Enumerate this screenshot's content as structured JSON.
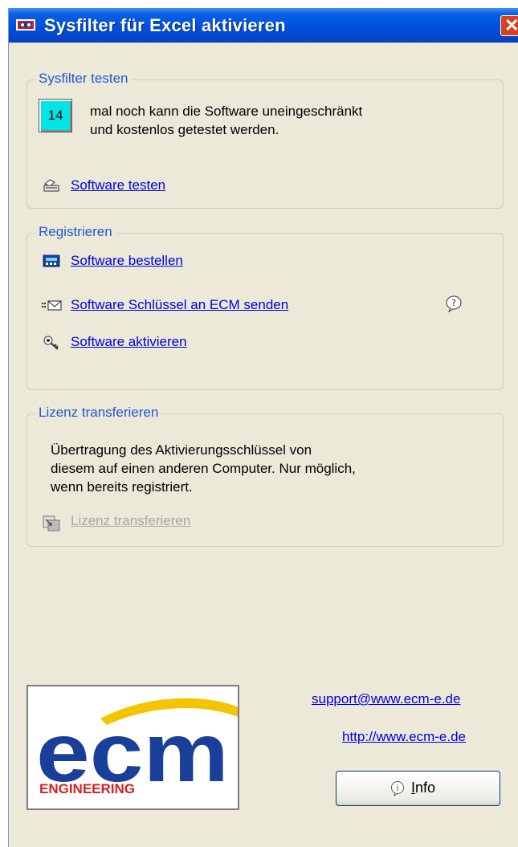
{
  "window": {
    "title": "Sysfilter für Excel aktivieren",
    "close_label": "✕"
  },
  "test_group": {
    "legend": "Sysfilter testen",
    "remaining_count": "14",
    "description_line1": "mal noch kann die Software uneingeschränkt",
    "description_line2": "und kostenlos getestet werden.",
    "test_link": "Software testen"
  },
  "register_group": {
    "legend": "Registrieren",
    "order_link": "Software bestellen",
    "send_key_link": "Software Schlüssel an ECM senden",
    "activate_link": "Software aktivieren"
  },
  "license_group": {
    "legend": "Lizenz transferieren",
    "description_line1": "Übertragung des Aktivierungsschlüssel von",
    "description_line2": "diesem auf einen anderen Computer. Nur möglich,",
    "description_line3": "wenn bereits registriert.",
    "transfer_link": "Lizenz transferieren"
  },
  "footer": {
    "logo_text": "ecm",
    "logo_subtext": "ENGINEERING",
    "support_email": "support@www.ecm-e.de",
    "website": "http://www.ecm-e.de",
    "info_button_label_underlined": "I",
    "info_button_label_rest": "nfo"
  },
  "colors": {
    "titlebar": "#0054e3",
    "window_bg": "#ece9d8",
    "link": "#0000e0",
    "legend": "#2157d4",
    "counter_bg": "#00e6e6",
    "logo_blue": "#1a3f9a",
    "logo_red": "#d42020"
  }
}
